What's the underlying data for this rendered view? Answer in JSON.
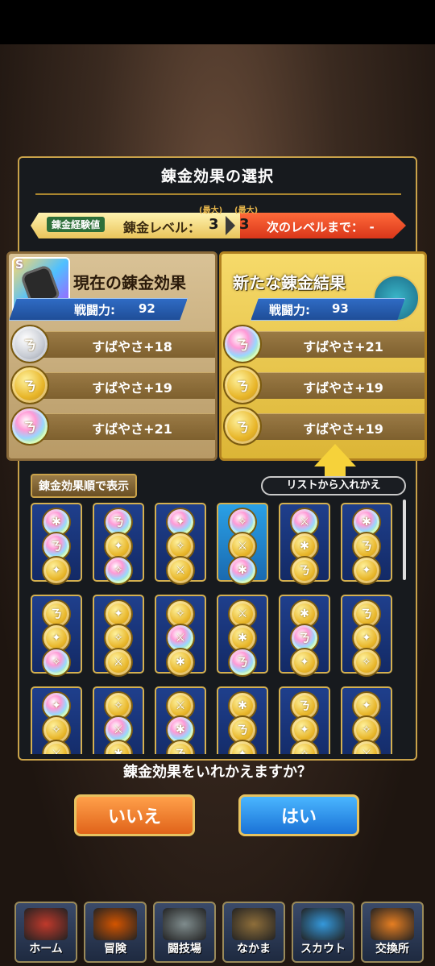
{
  "dialog": {
    "title": "錬金効果の選択",
    "exp_badge": "錬金経験値",
    "level_label": "錬金レベル：",
    "level_current": "3",
    "level_next": "3",
    "max_tag": "(最大)",
    "next_level_text": "次のレベルまで：　-"
  },
  "current": {
    "title": "現在の錬金効果",
    "rank": "S",
    "power_label": "戦闘力:",
    "power_value": "92",
    "effects": [
      {
        "text": "すばやさ+18",
        "coin": "silver"
      },
      {
        "text": "すばやさ+19",
        "coin": "gold"
      },
      {
        "text": "すばやさ+21",
        "coin": "rainbow"
      }
    ]
  },
  "new_result": {
    "title": "新たな錬金結果",
    "power_label": "戦闘力:",
    "power_value": "93",
    "effects": [
      {
        "text": "すばやさ+21",
        "coin": "rainbow"
      },
      {
        "text": "すばやさ+19",
        "coin": "gold"
      },
      {
        "text": "すばやさ+19",
        "coin": "gold"
      }
    ]
  },
  "sort_button": "錬金効果順で表示",
  "swap_label": "リストから入れかえ",
  "grid_cards": [
    [
      "rainbow",
      "rainbow",
      "gold"
    ],
    [
      "rainbow",
      "gold",
      "rainbow"
    ],
    [
      "rainbow",
      "gold",
      "gold"
    ],
    [
      "rainbow",
      "gold",
      "rainbow"
    ],
    [
      "rainbow",
      "gold",
      "gold"
    ],
    [
      "rainbow",
      "gold",
      "gold"
    ],
    [
      "gold",
      "gold",
      "rainbow"
    ],
    [
      "gold",
      "gold",
      "gold"
    ],
    [
      "gold",
      "rainbow",
      "gold"
    ],
    [
      "gold",
      "gold",
      "rainbow"
    ],
    [
      "gold",
      "rainbow",
      "gold"
    ],
    [
      "gold",
      "gold",
      "gold"
    ],
    [
      "rainbow",
      "gold",
      "gold"
    ],
    [
      "gold",
      "rainbow",
      "gold"
    ],
    [
      "gold",
      "rainbow",
      "gold"
    ],
    [
      "gold",
      "gold",
      "gold"
    ],
    [
      "gold",
      "gold",
      "gold"
    ],
    [
      "gold",
      "gold",
      "gold"
    ]
  ],
  "question": "錬金効果をいれかえますか？",
  "buttons": {
    "no": "いいえ",
    "yes": "はい"
  },
  "nav": [
    {
      "label": "ホーム",
      "color": "#c0392b"
    },
    {
      "label": "冒険",
      "color": "#d35400"
    },
    {
      "label": "闘技場",
      "color": "#7f8c8d"
    },
    {
      "label": "なかま",
      "color": "#8e6e3a"
    },
    {
      "label": "スカウト",
      "color": "#3498db"
    },
    {
      "label": "交換所",
      "color": "#e67e22"
    }
  ]
}
